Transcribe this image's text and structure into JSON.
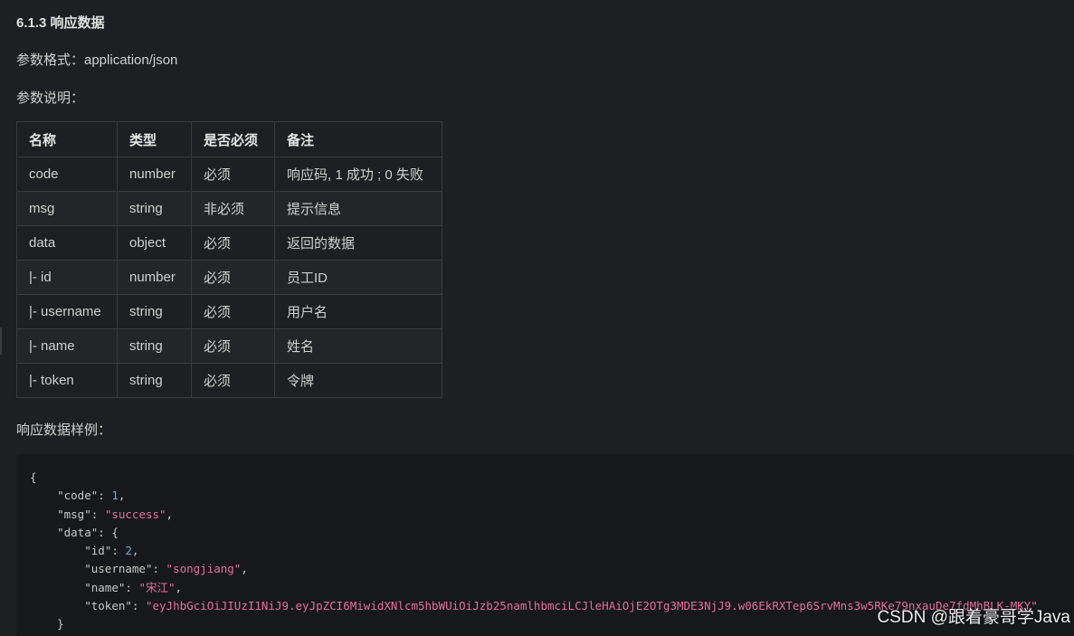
{
  "section_title": "6.1.3 响应数据",
  "param_format": "参数格式：application/json",
  "param_desc": "参数说明：",
  "table": {
    "headers": [
      "名称",
      "类型",
      "是否必须",
      "备注"
    ],
    "rows": [
      [
        "code",
        "number",
        "必须",
        "响应码, 1 成功 ; 0 失败"
      ],
      [
        "msg",
        "string",
        "非必须",
        "提示信息"
      ],
      [
        "data",
        "object",
        "必须",
        "返回的数据"
      ],
      [
        "|- id",
        "number",
        "必须",
        "员工ID"
      ],
      [
        "|- username",
        "string",
        "必须",
        "用户名"
      ],
      [
        "|- name",
        "string",
        "必须",
        "姓名"
      ],
      [
        "|- token",
        "string",
        "必须",
        "令牌"
      ]
    ]
  },
  "example_label": "响应数据样例：",
  "code_example": {
    "open": "{",
    "code_key": "\"code\"",
    "code_val": "1",
    "msg_key": "\"msg\"",
    "msg_val": "\"success\"",
    "data_key": "\"data\"",
    "id_key": "\"id\"",
    "id_val": "2",
    "username_key": "\"username\"",
    "username_val": "\"songjiang\"",
    "name_key": "\"name\"",
    "name_val": "\"宋江\"",
    "token_key": "\"token\"",
    "token_val": "\"eyJhbGciOiJIUzI1NiJ9.eyJpZCI6MiwidXNlcm5hbWUiOiJzb25namlhbmciLCJleHAiOjE2OTg3MDE3NjJ9.w06EkRXTep6SrvMns3w5RKe79nxauDe7fdMhBLK-MKY\"",
    "close_inner": "}"
  },
  "watermark": "CSDN @跟着豪哥学Java"
}
